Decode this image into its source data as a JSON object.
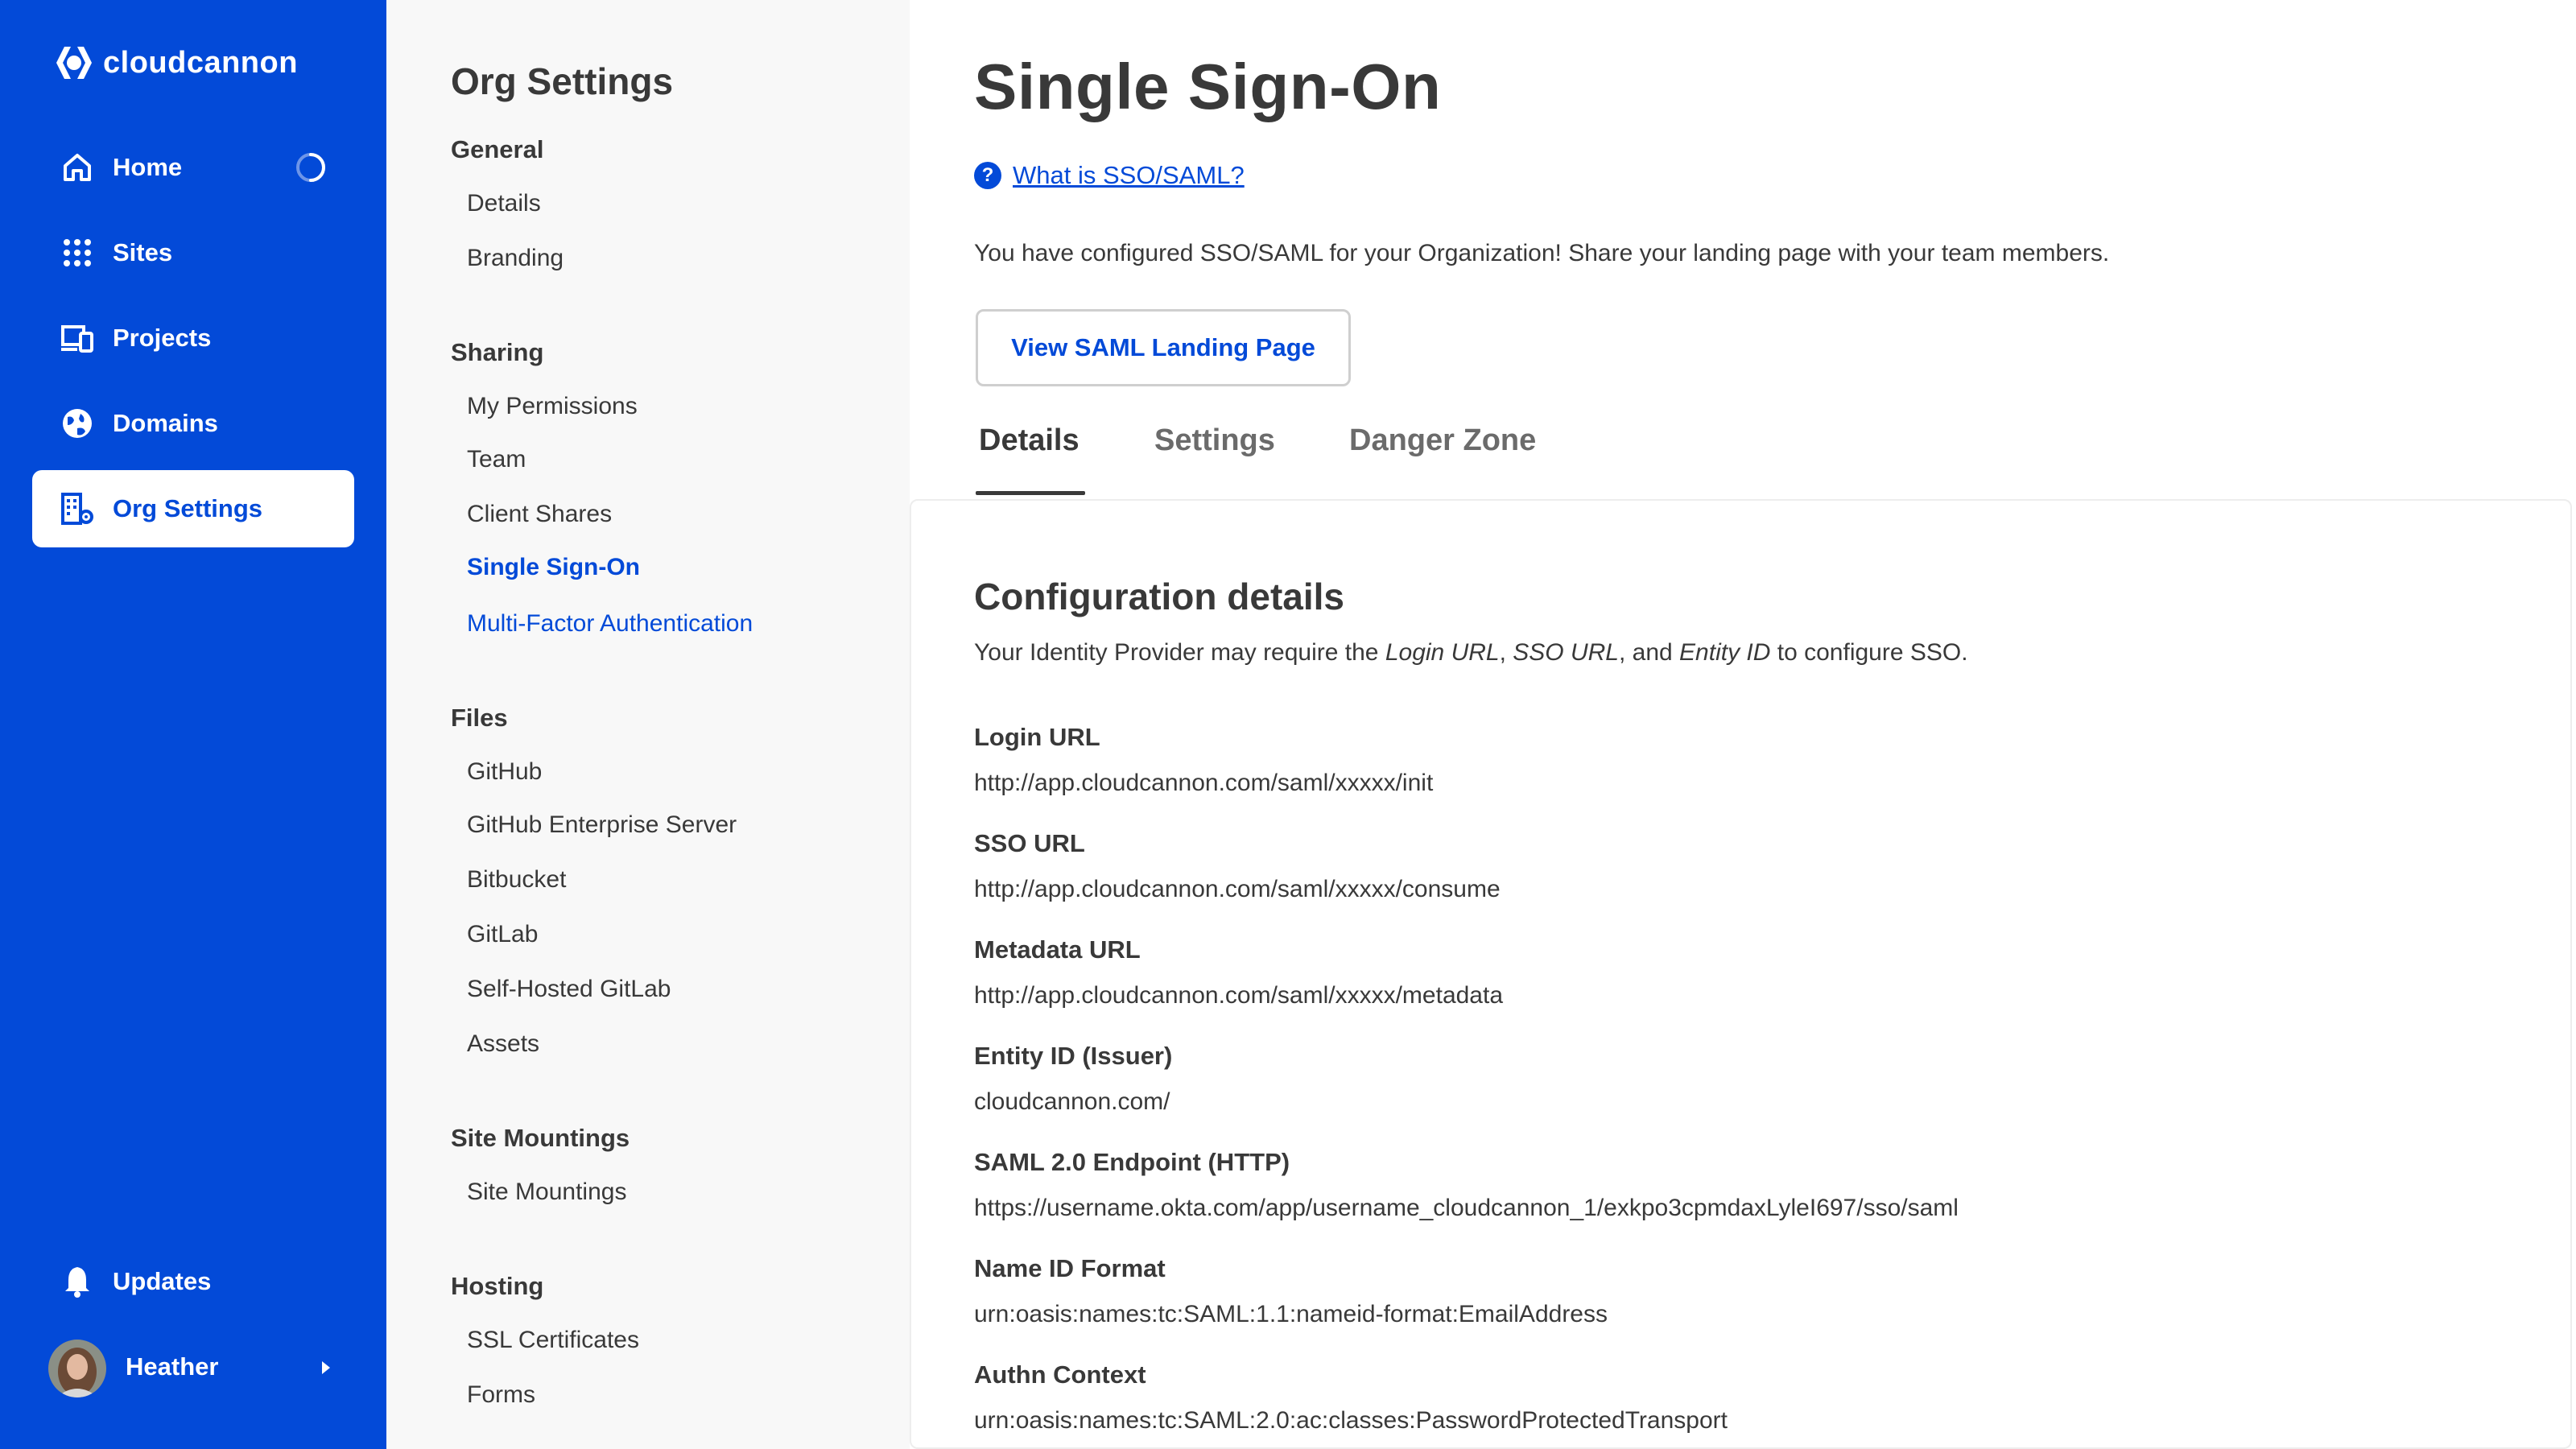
{
  "brand": {
    "name": "cloudcannon"
  },
  "sidebar": {
    "items": [
      {
        "label": "Home"
      },
      {
        "label": "Sites"
      },
      {
        "label": "Projects"
      },
      {
        "label": "Domains"
      },
      {
        "label": "Org Settings"
      }
    ],
    "updates_label": "Updates",
    "user_name": "Heather"
  },
  "subnav": {
    "title": "Org Settings",
    "groups": [
      {
        "heading": "General",
        "links": [
          "Details",
          "Branding"
        ]
      },
      {
        "heading": "Sharing",
        "links": [
          "My Permissions",
          "Team",
          "Client Shares",
          "Single Sign-On",
          "Multi-Factor Authentication"
        ]
      },
      {
        "heading": "Files",
        "links": [
          "GitHub",
          "GitHub Enterprise Server",
          "Bitbucket",
          "GitLab",
          "Self-Hosted GitLab",
          "Assets"
        ]
      },
      {
        "heading": "Site Mountings",
        "links": [
          "Site Mountings"
        ]
      },
      {
        "heading": "Hosting",
        "links": [
          "SSL Certificates",
          "Forms"
        ]
      }
    ]
  },
  "main": {
    "title": "Single Sign-On",
    "help_link": "What is SSO/SAML?",
    "intro": "You have configured SSO/SAML for your Organization! Share your landing page with your team members.",
    "landing_button": "View SAML Landing Page",
    "tabs": [
      {
        "label": "Details"
      },
      {
        "label": "Settings"
      },
      {
        "label": "Danger Zone"
      }
    ],
    "config": {
      "title": "Configuration details",
      "desc_prefix": "Your Identity Provider may require the ",
      "desc_login": "Login URL",
      "desc_sep1": ", ",
      "desc_sso": "SSO URL",
      "desc_sep2": ", and ",
      "desc_entity": "Entity ID",
      "desc_suffix": " to configure SSO.",
      "fields": [
        {
          "label": "Login URL",
          "value": "http://app.cloudcannon.com/saml/xxxxx/init"
        },
        {
          "label": "SSO URL",
          "value": "http://app.cloudcannon.com/saml/xxxxx/consume"
        },
        {
          "label": "Metadata URL",
          "value": "http://app.cloudcannon.com/saml/xxxxx/metadata"
        },
        {
          "label": "Entity ID (Issuer)",
          "value": "cloudcannon.com/"
        },
        {
          "label": "SAML 2.0 Endpoint (HTTP)",
          "value": "https://username.okta.com/app/username_cloudcannon_1/exkpo3cpmdaxLyleI697/sso/saml"
        },
        {
          "label": "Name ID Format",
          "value": "urn:oasis:names:tc:SAML:1.1:nameid-format:EmailAddress"
        },
        {
          "label": "Authn Context",
          "value": "urn:oasis:names:tc:SAML:2.0:ac:classes:PasswordProtectedTransport"
        }
      ]
    }
  },
  "colors": {
    "brand_blue": "#034ad8",
    "text": "#393939",
    "subnav_bg": "#f8f8f8"
  }
}
